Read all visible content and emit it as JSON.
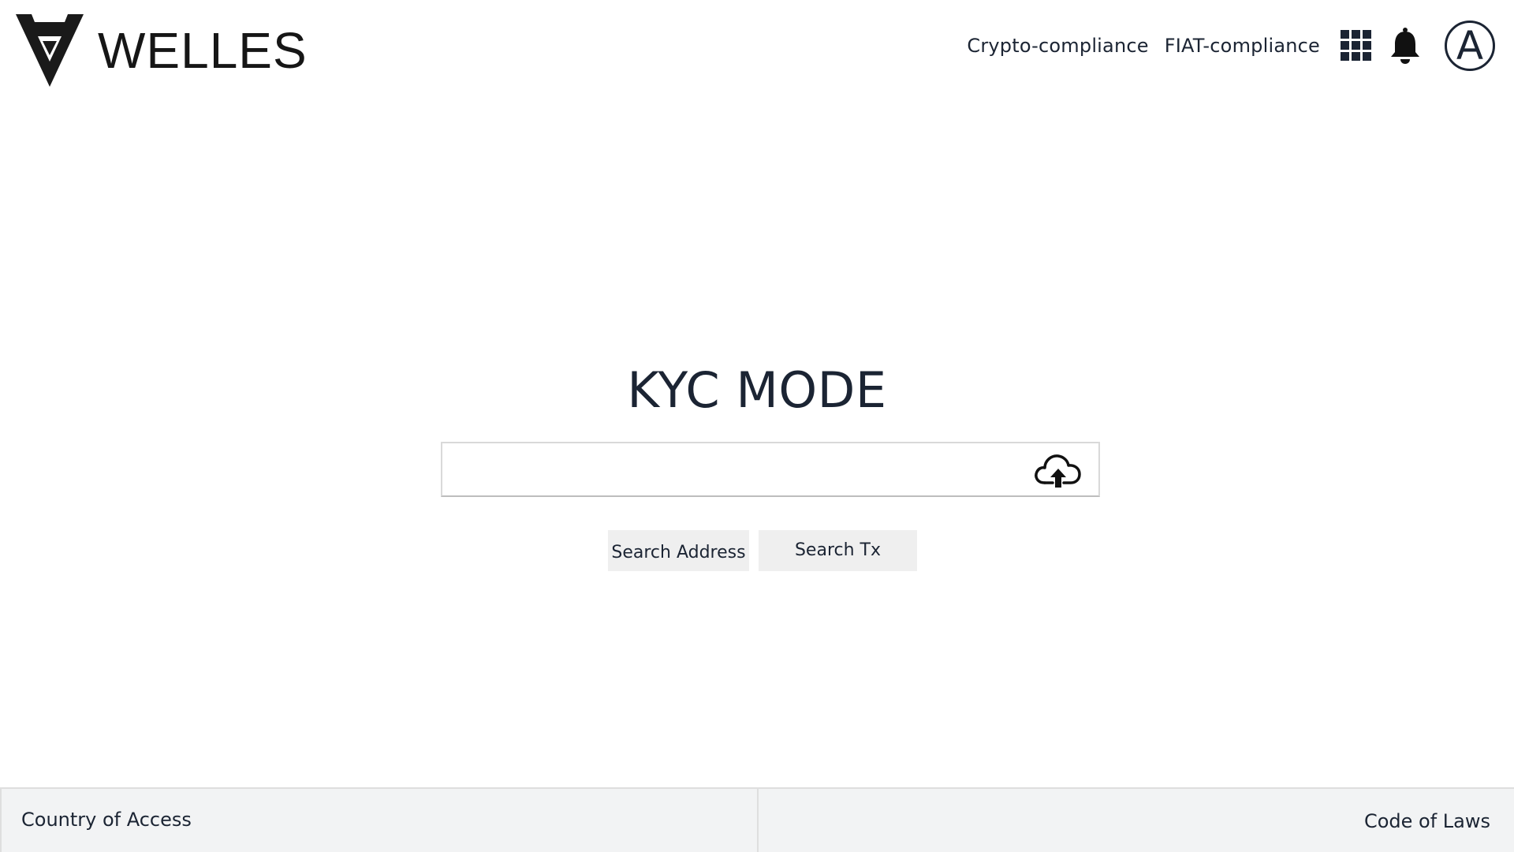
{
  "brand": {
    "name": "WELLES"
  },
  "nav": {
    "links": [
      "Crypto-compliance",
      "FIAT-compliance"
    ],
    "apps_icon": "grid-apps-icon",
    "notifications_icon": "bell-icon",
    "avatar_initial": "A"
  },
  "main": {
    "title": "KYC MODE",
    "search": {
      "value": "",
      "placeholder": "",
      "upload_icon": "cloud-upload-icon"
    },
    "buttons": {
      "search_address": "Search Address",
      "search_tx": "Search Tx"
    }
  },
  "footer": {
    "left": "Country of Access",
    "right": "Code of Laws"
  },
  "colors": {
    "text": "#1b2433",
    "button_bg": "#efefef",
    "footer_bg": "#f2f3f4"
  }
}
